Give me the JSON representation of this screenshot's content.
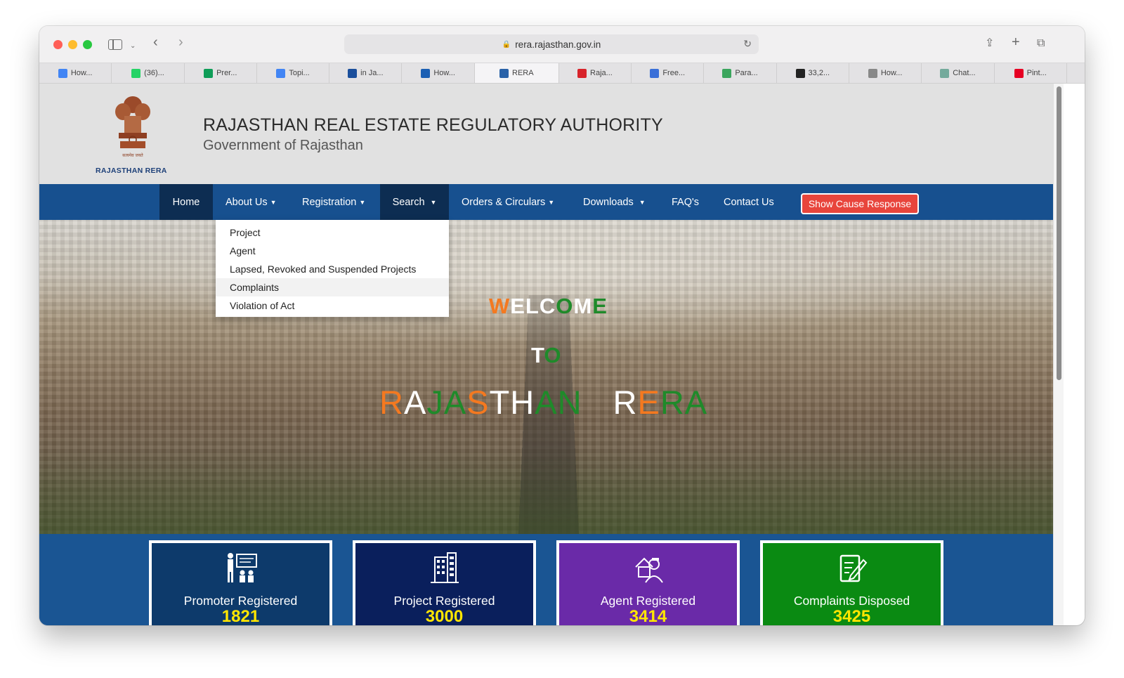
{
  "browser": {
    "url": "rera.rajasthan.gov.in",
    "tabs": [
      {
        "label": "How...",
        "favicon": "google-icon",
        "color": "#4285f4"
      },
      {
        "label": "(36)...",
        "favicon": "whatsapp-icon",
        "color": "#25d366"
      },
      {
        "label": "Prer...",
        "favicon": "sheets-icon",
        "color": "#0f9d58"
      },
      {
        "label": "Topi...",
        "favicon": "docs-icon",
        "color": "#4285f4"
      },
      {
        "label": "in Ja...",
        "favicon": "app-icon",
        "color": "#1b4f9c"
      },
      {
        "label": "How...",
        "favicon": "99acres-icon",
        "color": "#1b5fb3"
      },
      {
        "label": "RERA",
        "favicon": "rera-icon",
        "color": "#2a62a8"
      },
      {
        "label": "Raja...",
        "favicon": "magicbricks-icon",
        "color": "#d8232a"
      },
      {
        "label": "Free...",
        "favicon": "forms-icon",
        "color": "#3a6fd8"
      },
      {
        "label": "Para...",
        "favicon": "robot-icon",
        "color": "#3ba55d"
      },
      {
        "label": "33,2...",
        "favicon": "is-icon",
        "color": "#222222"
      },
      {
        "label": "How...",
        "favicon": "g-icon",
        "color": "#888888"
      },
      {
        "label": "Chat...",
        "favicon": "chatgpt-icon",
        "color": "#74aa9c"
      },
      {
        "label": "Pint...",
        "favicon": "pinterest-icon",
        "color": "#e60023"
      }
    ]
  },
  "header": {
    "emblem_caption": "RAJASTHAN RERA",
    "title": "RAJASTHAN REAL ESTATE REGULATORY AUTHORITY",
    "subtitle": "Government of Rajasthan"
  },
  "nav": {
    "home": "Home",
    "about": "About Us",
    "registration": "Registration",
    "search": "Search",
    "orders": "Orders & Circulars",
    "downloads": "Downloads",
    "faqs": "FAQ's",
    "contact": "Contact Us",
    "show_cause": "Show Cause Response"
  },
  "search_menu": {
    "items": [
      "Project",
      "Agent",
      "Lapsed, Revoked and Suspended Projects",
      "Complaints",
      "Violation of Act"
    ],
    "hovered": "Complaints"
  },
  "hero": {
    "welcome": [
      "W",
      "E",
      "L",
      "C",
      "O",
      "M",
      "E"
    ],
    "to": [
      "T",
      "O"
    ],
    "rajasthan": [
      "R",
      "A",
      "J",
      "A",
      "S",
      "T",
      "H",
      "A",
      "N"
    ],
    "rera": [
      "R",
      "E",
      "R",
      "A"
    ]
  },
  "stats": [
    {
      "label": "Promoter Registered",
      "count": "1821",
      "color": "#0d3a6b",
      "icon": "teacher-icon"
    },
    {
      "label": "Project Registered",
      "count": "3000",
      "color": "#0a1f5c",
      "icon": "building-icon"
    },
    {
      "label": "Agent Registered",
      "count": "3414",
      "color": "#6a2aa8",
      "icon": "agent-icon"
    },
    {
      "label": "Complaints Disposed",
      "count": "3425",
      "color": "#0a8a12",
      "icon": "complaint-icon"
    }
  ],
  "colors": {
    "navbar": "#17508f",
    "nav_active": "#0d2d52",
    "show_cause": "#e8453c",
    "saffron": "#f47920",
    "green": "#1f8a2a"
  }
}
